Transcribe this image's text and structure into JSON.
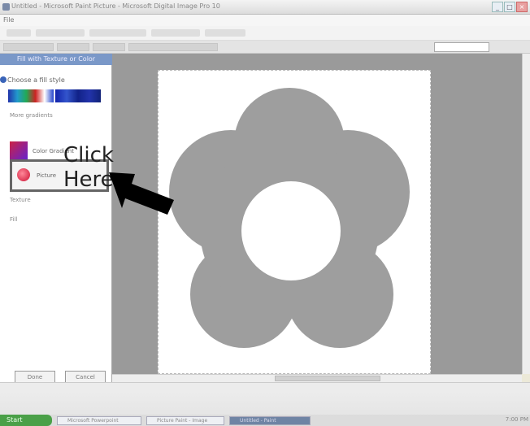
{
  "window": {
    "title": "Untitled - Microsoft Paint Picture - Microsoft Digital Image Pro 10",
    "menu": "File"
  },
  "taskpane": {
    "header": "Fill with Texture or Color",
    "section": "Choose a fill style",
    "more_label": "More gradients",
    "gradient_label": "Color Gradient",
    "picture_label": "Picture",
    "row1": "Texture",
    "row2": "Fill",
    "done": "Done",
    "cancel": "Cancel"
  },
  "callout": {
    "line1": "Click",
    "line2": "Here"
  },
  "taskbar": {
    "start": "Start",
    "tasks": [
      "Microsoft Powerpoint",
      "Picture Paint - Image",
      "Untitled - Paint"
    ],
    "tray": "7:00 PM"
  },
  "colors": {
    "flower": "#9e9e9e",
    "canvas_bg": "#9a9a9a",
    "arrow": "#000000"
  }
}
